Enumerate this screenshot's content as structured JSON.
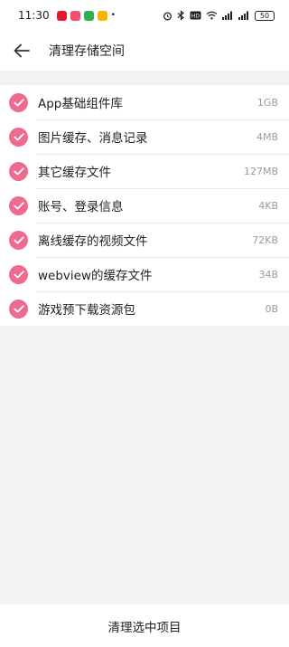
{
  "status_bar": {
    "time": "11:30",
    "battery": "50",
    "app_icons": [
      {
        "name": "weibo-icon",
        "color": "#e6162d"
      },
      {
        "name": "app-red-icon",
        "color": "#f0506e"
      },
      {
        "name": "app-green-icon",
        "color": "#2fae4f"
      },
      {
        "name": "app-yellow-icon",
        "color": "#f4b400"
      }
    ]
  },
  "header": {
    "title": "清理存储空间",
    "back_icon": "arrow-left-icon"
  },
  "items": [
    {
      "label": "App基础组件库",
      "size": "1GB",
      "checked": true
    },
    {
      "label": "图片缓存、消息记录",
      "size": "4MB",
      "checked": true
    },
    {
      "label": "其它缓存文件",
      "size": "127MB",
      "checked": true
    },
    {
      "label": "账号、登录信息",
      "size": "4KB",
      "checked": true
    },
    {
      "label": "离线缓存的视频文件",
      "size": "72KB",
      "checked": true
    },
    {
      "label": "webview的缓存文件",
      "size": "34B",
      "checked": true
    },
    {
      "label": "游戏预下载资源包",
      "size": "0B",
      "checked": true
    }
  ],
  "footer": {
    "action_label": "清理选中项目"
  },
  "colors": {
    "accent": "#ef6a8f",
    "background": "#f2f2f4",
    "surface": "#ffffff",
    "secondary_text": "#9b9b9b"
  }
}
